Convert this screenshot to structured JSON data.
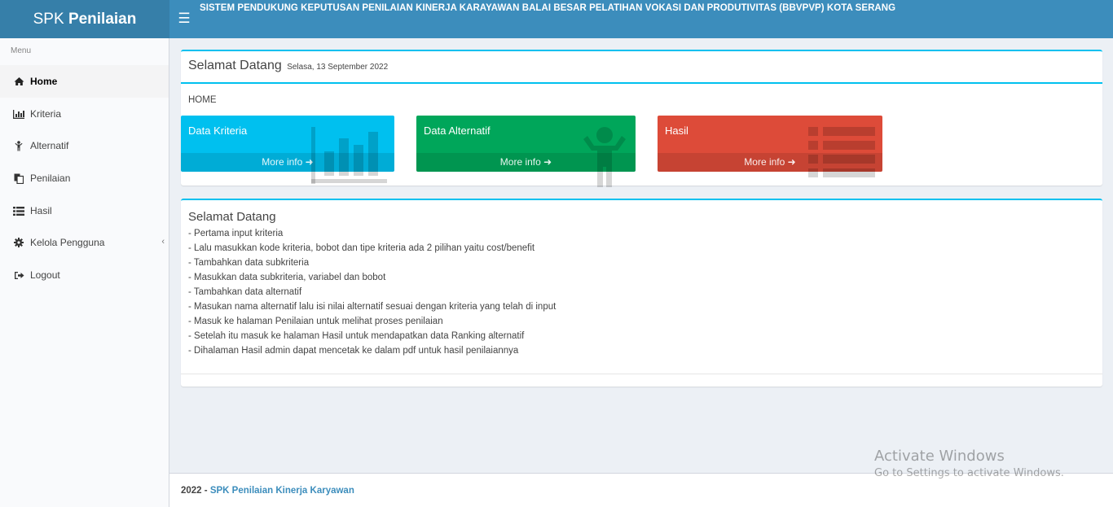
{
  "header": {
    "logo_light": "SPK ",
    "logo_bold": "Penilaian",
    "toggle_icon": "hamburger-icon",
    "app_title": "SISTEM PENDUKUNG KEPUTUSAN PENILAIAN KINERJA KARAYAWAN BALAI BESAR PELATIHAN VOKASI DAN PRODUTIVITAS (BBVPVP) KOTA SERANG"
  },
  "sidebar": {
    "header": "Menu",
    "items": [
      {
        "label": "Home",
        "icon": "home-icon",
        "active": true
      },
      {
        "label": "Kriteria",
        "icon": "bar-chart-icon"
      },
      {
        "label": "Alternatif",
        "icon": "person-icon"
      },
      {
        "label": "Penilaian",
        "icon": "copy-icon"
      },
      {
        "label": "Hasil",
        "icon": "list-icon"
      },
      {
        "label": "Kelola Pengguna",
        "icon": "gear-icon",
        "has_chevron": true,
        "chevron_icon": "chevron-left-icon"
      },
      {
        "label": "Logout",
        "icon": "sign-out-icon"
      }
    ]
  },
  "welcome_box": {
    "title": "Selamat Datang",
    "date": "Selasa, 13 September 2022",
    "breadcrumb": "HOME"
  },
  "tiles": [
    {
      "title": "Data Kriteria",
      "more": "More info",
      "color": "#00c0ef",
      "icon": "bar-chart-icon"
    },
    {
      "title": "Data Alternatif",
      "more": "More info",
      "color": "#00a65a",
      "icon": "person-icon"
    },
    {
      "title": "Hasil",
      "more": "More info",
      "color": "#dd4b39",
      "icon": "list-icon"
    }
  ],
  "instructions": {
    "title": "Selamat Datang",
    "lines": [
      "- Pertama input kriteria",
      "- Lalu masukkan kode kriteria, bobot dan tipe kriteria ada 2 pilihan yaitu cost/benefit",
      "- Tambahkan data subkriteria",
      "- Masukkan data subkriteria, variabel dan bobot",
      "- Tambahkan data alternatif",
      "- Masukan nama alternatif lalu isi nilai alternatif sesuai dengan kriteria yang telah di input",
      "- Masuk ke halaman Penilaian untuk melihat proses penilaian",
      "- Setelah itu masuk ke halaman Hasil untuk mendapatkan data Ranking alternatif",
      "- Dihalaman Hasil admin dapat mencetak ke dalam pdf untuk hasil penilaiannya"
    ]
  },
  "footer": {
    "year": "2022 - ",
    "link": "SPK Penilaian Kinerja Karyawan"
  },
  "watermark": {
    "line1": "Activate Windows",
    "line2": "Go to Settings to activate Windows."
  },
  "colors": {
    "primary": "#3c8dbc",
    "primary_dark": "#367fa9",
    "accent": "#00c0ef"
  }
}
